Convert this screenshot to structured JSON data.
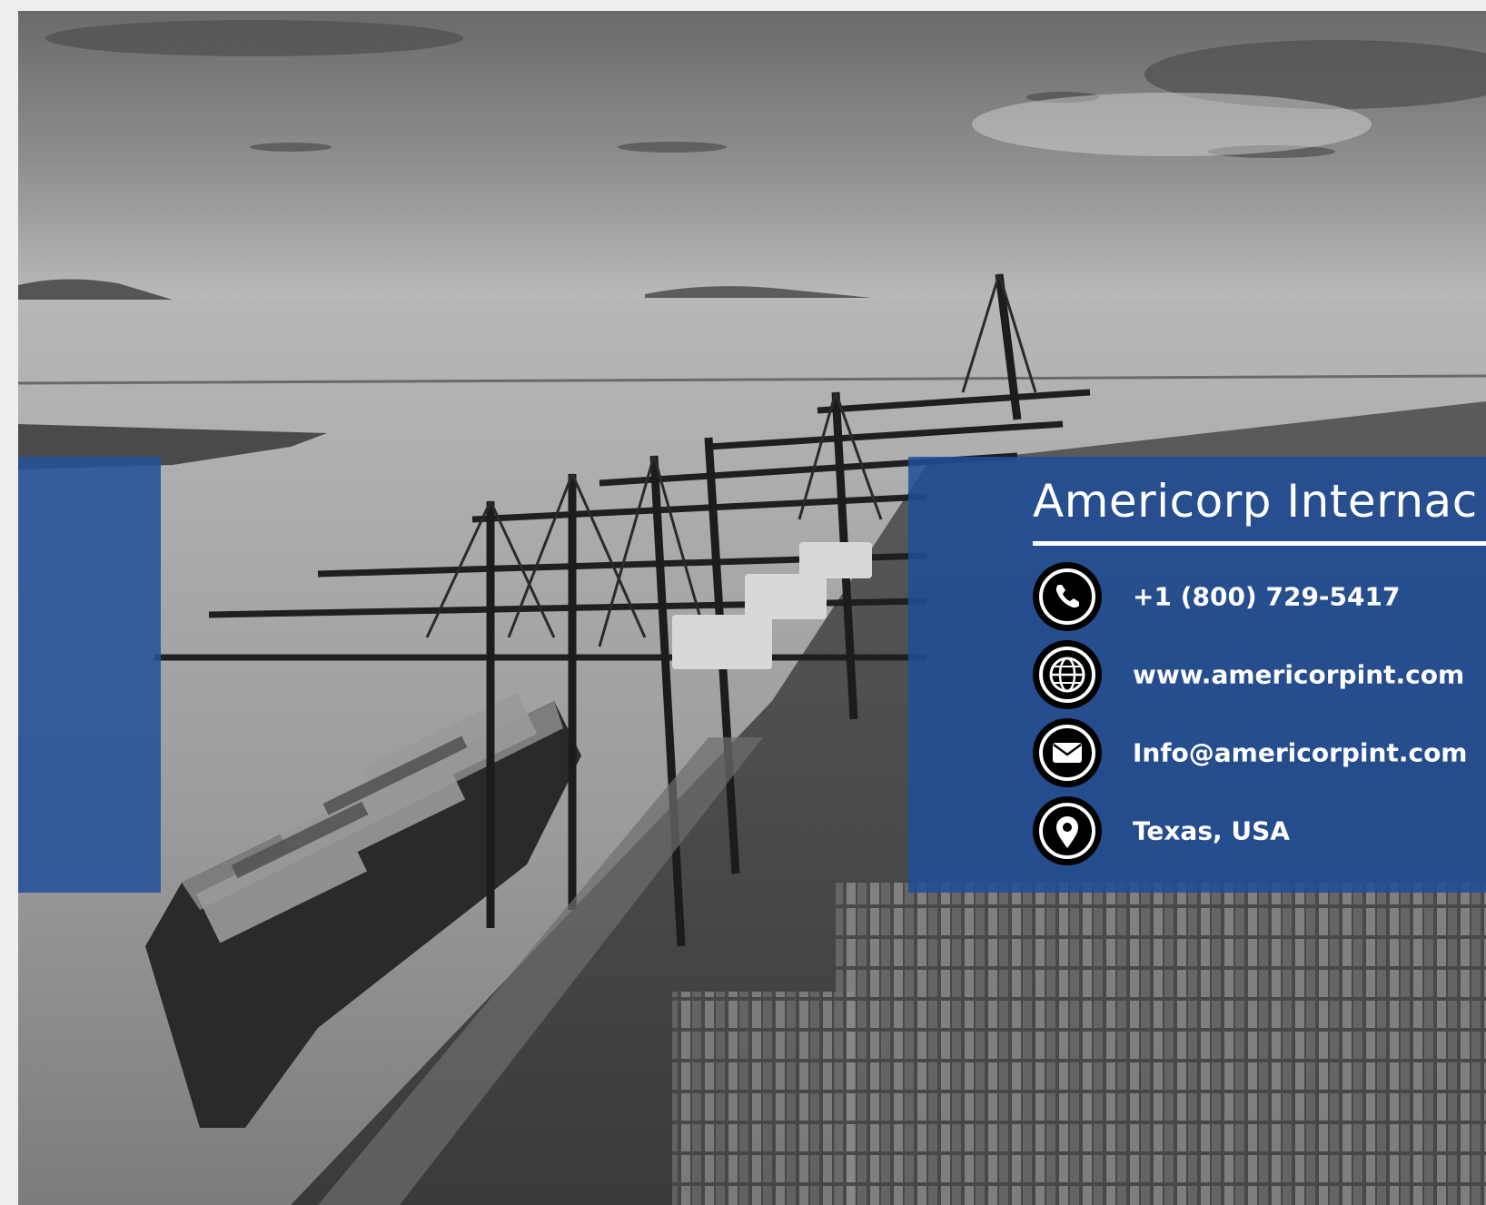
{
  "company": {
    "name": "Americorp Internac"
  },
  "contacts": [
    {
      "icon": "phone-icon",
      "text": "+1 (800) 729-5417"
    },
    {
      "icon": "globe-icon",
      "text": "www.americorpint.com"
    },
    {
      "icon": "mail-icon",
      "text": "Info@americorpint.com"
    },
    {
      "icon": "location-pin-icon",
      "text": "Texas, USA"
    }
  ],
  "colors": {
    "panel_blue": "#1f4d99",
    "band_blue": "#255199",
    "icon_ring": "#000000",
    "text": "#ffffff"
  }
}
